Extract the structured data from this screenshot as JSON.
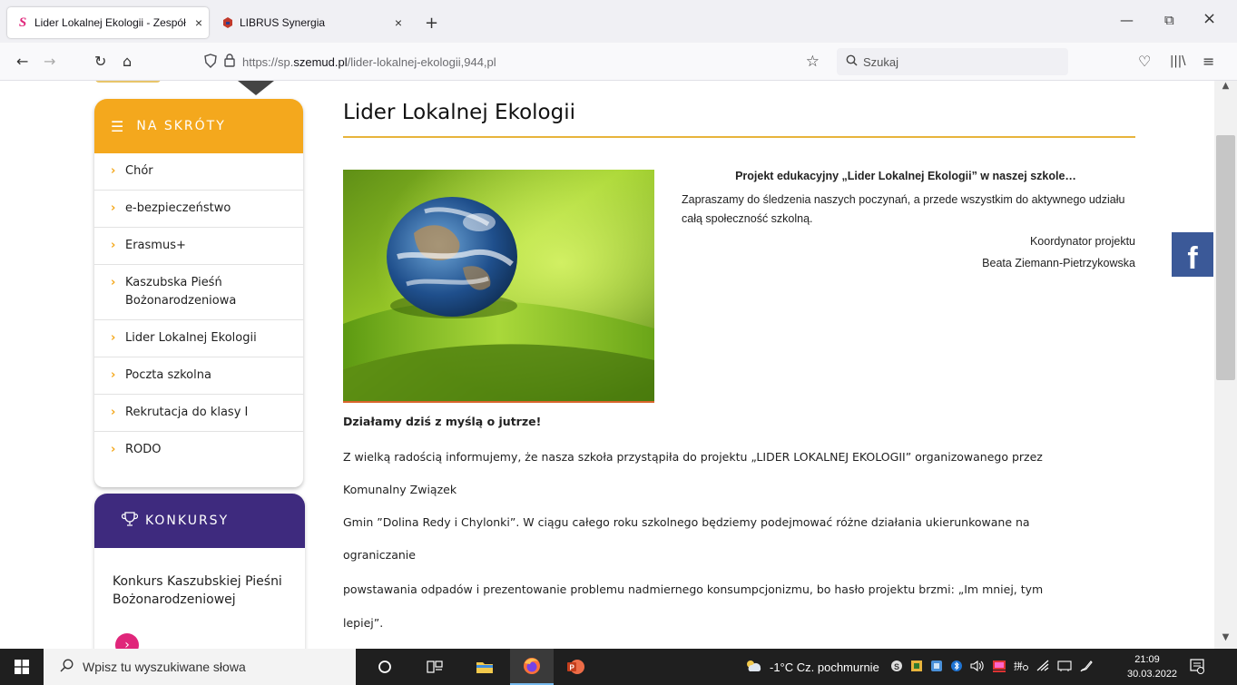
{
  "browser": {
    "tabs": [
      {
        "title": "Lider Lokalnej Ekologii - Zespół",
        "close": "×",
        "active": true,
        "favicon_color": "#e0267a",
        "favicon": "S"
      },
      {
        "title": "LIBRUS Synergia",
        "close": "×",
        "active": false,
        "favicon_color": "#c0392b"
      }
    ],
    "new_tab": "+",
    "window_controls": {
      "minimize": "—",
      "restore": "⧉",
      "close": "×"
    },
    "nav": {
      "back": "←",
      "forward": "→",
      "reload": "↻",
      "home": "⌂"
    },
    "url": {
      "prefix": "https://sp.",
      "host": "szemud.pl",
      "path": "/lider-lokalnej-ekologii,944,pl"
    },
    "star": "☆",
    "search_placeholder": "Szukaj",
    "toolbar_right": {
      "pocket": "♡",
      "library": "|||\\",
      "menu": "≡"
    }
  },
  "sidebar": {
    "shortcuts": {
      "title": "NA SKRÓTY",
      "color": "#f4a81d",
      "items": [
        {
          "label": "Chór"
        },
        {
          "label": "e-bezpieczeństwo"
        },
        {
          "label": "Erasmus+"
        },
        {
          "label": "Kaszubska Pieśń Bożonarodzeniowa"
        },
        {
          "label": "Lider Lokalnej Ekologii"
        },
        {
          "label": "Poczta szkolna"
        },
        {
          "label": "Rekrutacja do klasy I"
        },
        {
          "label": "RODO"
        }
      ]
    },
    "contests": {
      "title": "KONKURSY",
      "color": "#3e2a7e",
      "text": "Konkurs Kaszubskiej Pieśni Bożonarodzeniowej",
      "more_icon": "›"
    }
  },
  "main": {
    "title": "Lider Lokalnej Ekologii",
    "intro": {
      "headline": "Projekt edukacyjny „Lider Lokalnej Ekologii” w naszej szkole…",
      "body": "Zapraszamy do śledzenia naszych poczynań, a przede wszystkim do aktywnego udziału całą społeczność szkolną.",
      "coordinator_role": "Koordynator projektu",
      "coordinator_name": "Beata Ziemann-Pietrzykowska"
    },
    "paragraphs": {
      "bold": "Działamy dziś z myślą o jutrze!",
      "l1": "Z wielką radością informujemy, że nasza szkoła przystąpiła do projektu „LIDER LOKALNEJ EKOLOGII” organizowanego przez",
      "l2": "Komunalny Związek",
      "l3": "Gmin ”Dolina Redy i Chylonki”. W ciągu całego roku szkolnego będziemy podejmować różne działania ukierunkowane na",
      "l4": "ograniczanie",
      "l5": "powstawania odpadów i prezentowanie problemu nadmiernego konsumpcjonizmu, bo hasło projektu brzmi: „Im mniej, tym",
      "l6": "lepiej”."
    },
    "facebook": "f"
  },
  "taskbar": {
    "search_placeholder": "Wpisz tu wyszukiwane słowa",
    "weather": "-1°C  Cz. pochmurnie",
    "time": "21:09",
    "date": "30.03.2022"
  }
}
